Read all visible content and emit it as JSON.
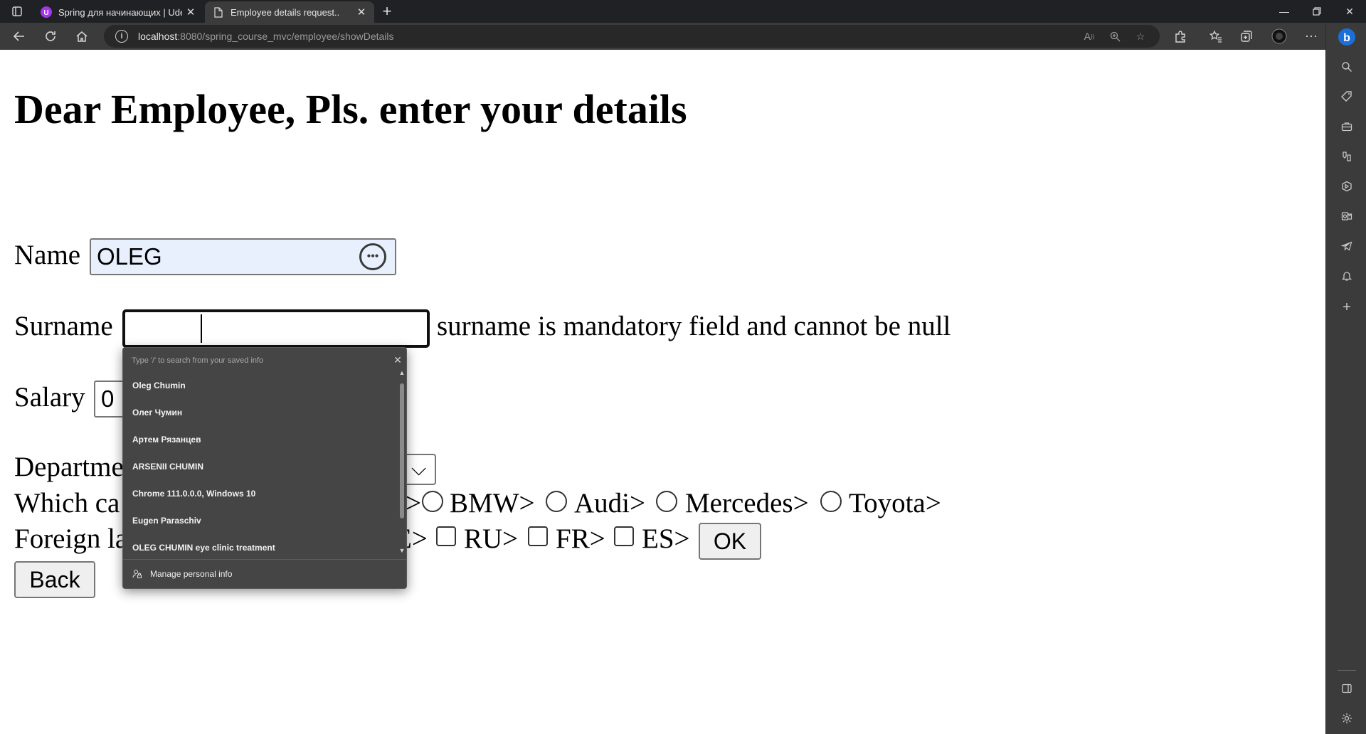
{
  "browser": {
    "tabs": [
      {
        "title": "Spring для начинающих | Udem",
        "favicon": "udemy-icon",
        "active": false
      },
      {
        "title": "Employee details request..",
        "favicon": "page-icon",
        "active": true
      }
    ],
    "address": {
      "host": "localhost",
      "rest": ":8080/spring_course_mvc/employee/showDetails"
    }
  },
  "form": {
    "heading": "Dear Employee, Pls. enter your details",
    "name_label": "Name",
    "name_value": "OLEG",
    "surname_label": "Surname",
    "surname_value": "",
    "surname_error": "surname is mandatory field and cannot be null",
    "salary_label": "Salary",
    "salary_value": "0",
    "department_label": "Departme",
    "car_label": "Which ca",
    "car_options": [
      "BMW>",
      "Audi>",
      "Mercedes>",
      "Toyota>"
    ],
    "car_partial_gt": ">",
    "language_label": "Foreign la",
    "language_partial": "E>",
    "language_options": [
      "RU>",
      "FR>",
      "ES>"
    ],
    "ok_button": "OK",
    "back_button": "Back"
  },
  "autofill": {
    "hint": "Type '/' to search from your saved info",
    "items": [
      "Oleg Chumin",
      "Олег Чумин",
      "Артем Рязанцев",
      "ARSENII CHUMIN",
      "Chrome 111.0.0.0, Windows 10",
      "Eugen Paraschiv",
      "OLEG CHUMIN eye clinic treatment"
    ],
    "footer": "Manage personal info"
  },
  "icons": {
    "autofill_indicator": "password-manager-icon",
    "sidebar": [
      "search-icon",
      "tag-icon",
      "briefcase-icon",
      "games-icon",
      "office-icon",
      "outlook-icon",
      "telegram-icon",
      "bell-icon",
      "plus-icon",
      "split-screen-icon",
      "settings-icon"
    ]
  },
  "colors": {
    "chrome_dark": "#202124",
    "toolbar": "#3b3b3b",
    "autofill_bg": "#e8f0fe",
    "popup_bg": "#454545"
  }
}
